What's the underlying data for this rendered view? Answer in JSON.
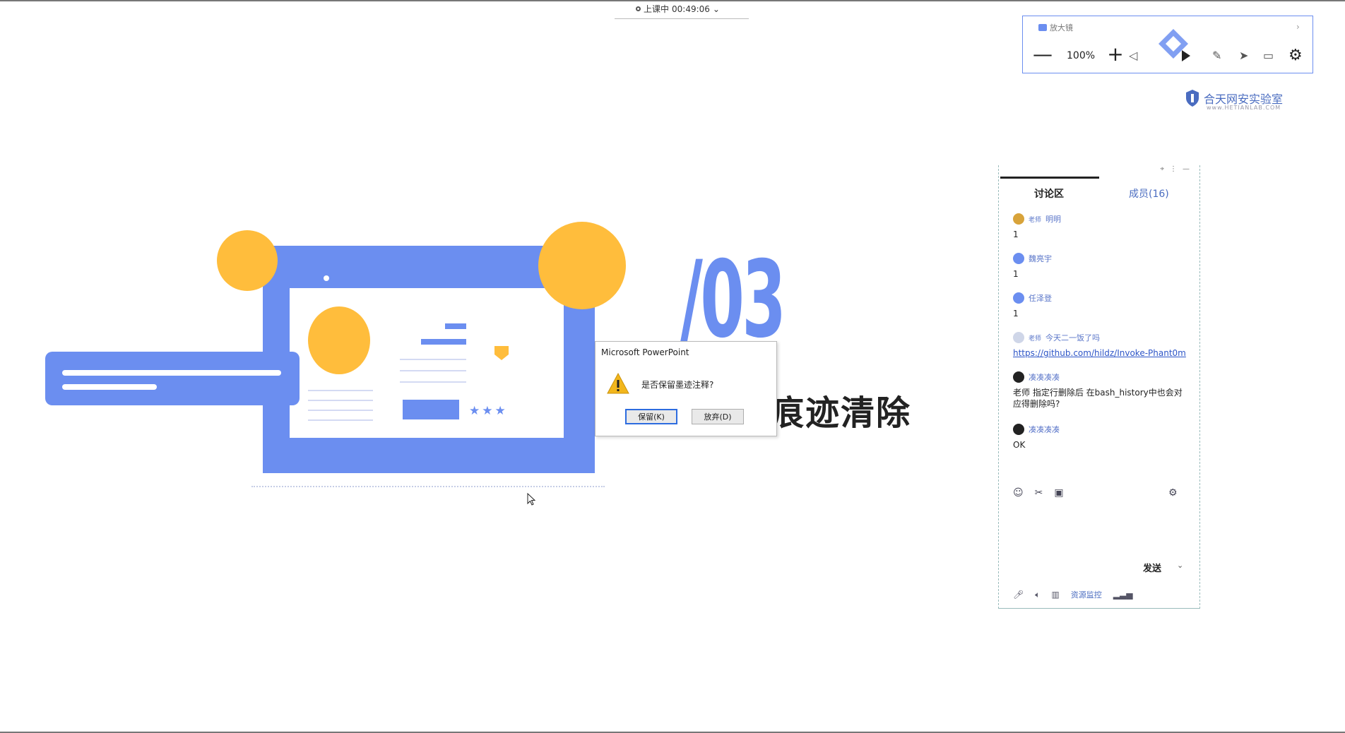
{
  "status": {
    "label": "上课中",
    "time": "00:49:06",
    "chevron": "⌄"
  },
  "toolbar": {
    "label": "放大镜",
    "zoom_out": "—",
    "zoom_level": "100%",
    "zoom_in": "+",
    "accent": "#6b8ef0"
  },
  "brand": {
    "name": "合天网安实验室",
    "url": "www.HETIANLAB.COM"
  },
  "slide": {
    "number": "/03",
    "title": "痕迹清除",
    "stars": "★★★",
    "colors": {
      "blue": "#6b8ef0",
      "yellow": "#ffbd3c"
    }
  },
  "dialog": {
    "title": "Microsoft PowerPoint",
    "message": "是否保留墨迹注释?",
    "keep": "保留(K)",
    "discard": "放弃(D)"
  },
  "panel": {
    "tab_discussion": "讨论区",
    "tab_members": "成员(16)",
    "messages": [
      {
        "tag": "老师",
        "name": "明明",
        "body": "1",
        "avatar_color": "#d8a33a"
      },
      {
        "tag": "",
        "name": "魏亮宇",
        "body": "1",
        "avatar_color": "#6b8ef0"
      },
      {
        "tag": "",
        "name": "任泽登",
        "body": "1",
        "avatar_color": "#6b8ef0"
      },
      {
        "tag": "老师",
        "name": "今天二一饭了吗",
        "body": "https://github.com/hildz/Invoke-Phant0m",
        "avatar_color": "#cfd6e8"
      },
      {
        "tag": "",
        "name": "凑凑凑凑",
        "body": "老师  指定行删除后 在bash_history中也会对应得删除吗?",
        "avatar_color": "#222222"
      },
      {
        "tag": "",
        "name": "凑凑凑凑",
        "body": "OK",
        "avatar_color": "#222222"
      }
    ],
    "send": "发送",
    "resource_monitor": "资源监控"
  }
}
